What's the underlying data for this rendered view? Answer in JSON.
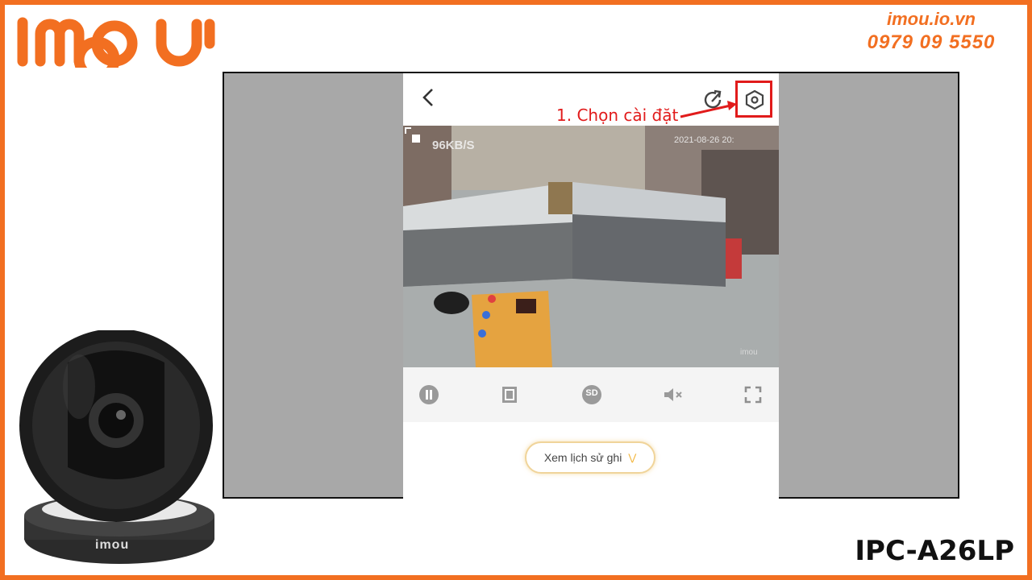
{
  "brand": {
    "logo_text": "imou"
  },
  "contact": {
    "website": "imou.io.vn",
    "phone": "0979 09 5550"
  },
  "model": "IPC-A26LP",
  "app": {
    "annotation": "1. Chọn cài đặt",
    "video": {
      "bitrate": "96KB/S",
      "timestamp": "2021-08-26 20:",
      "watermark": "imou"
    },
    "controls": [
      "pause-icon",
      "split-screen-icon",
      "sd-quality-icon",
      "mute-icon",
      "fullscreen-icon"
    ],
    "controls_labels": {
      "quality": "SD"
    },
    "history_button": "Xem lịch sử ghi"
  },
  "camera": {
    "base_logo": "imou"
  },
  "colors": {
    "brand_orange": "#f26f21",
    "annotation_red": "#e11b1b"
  }
}
